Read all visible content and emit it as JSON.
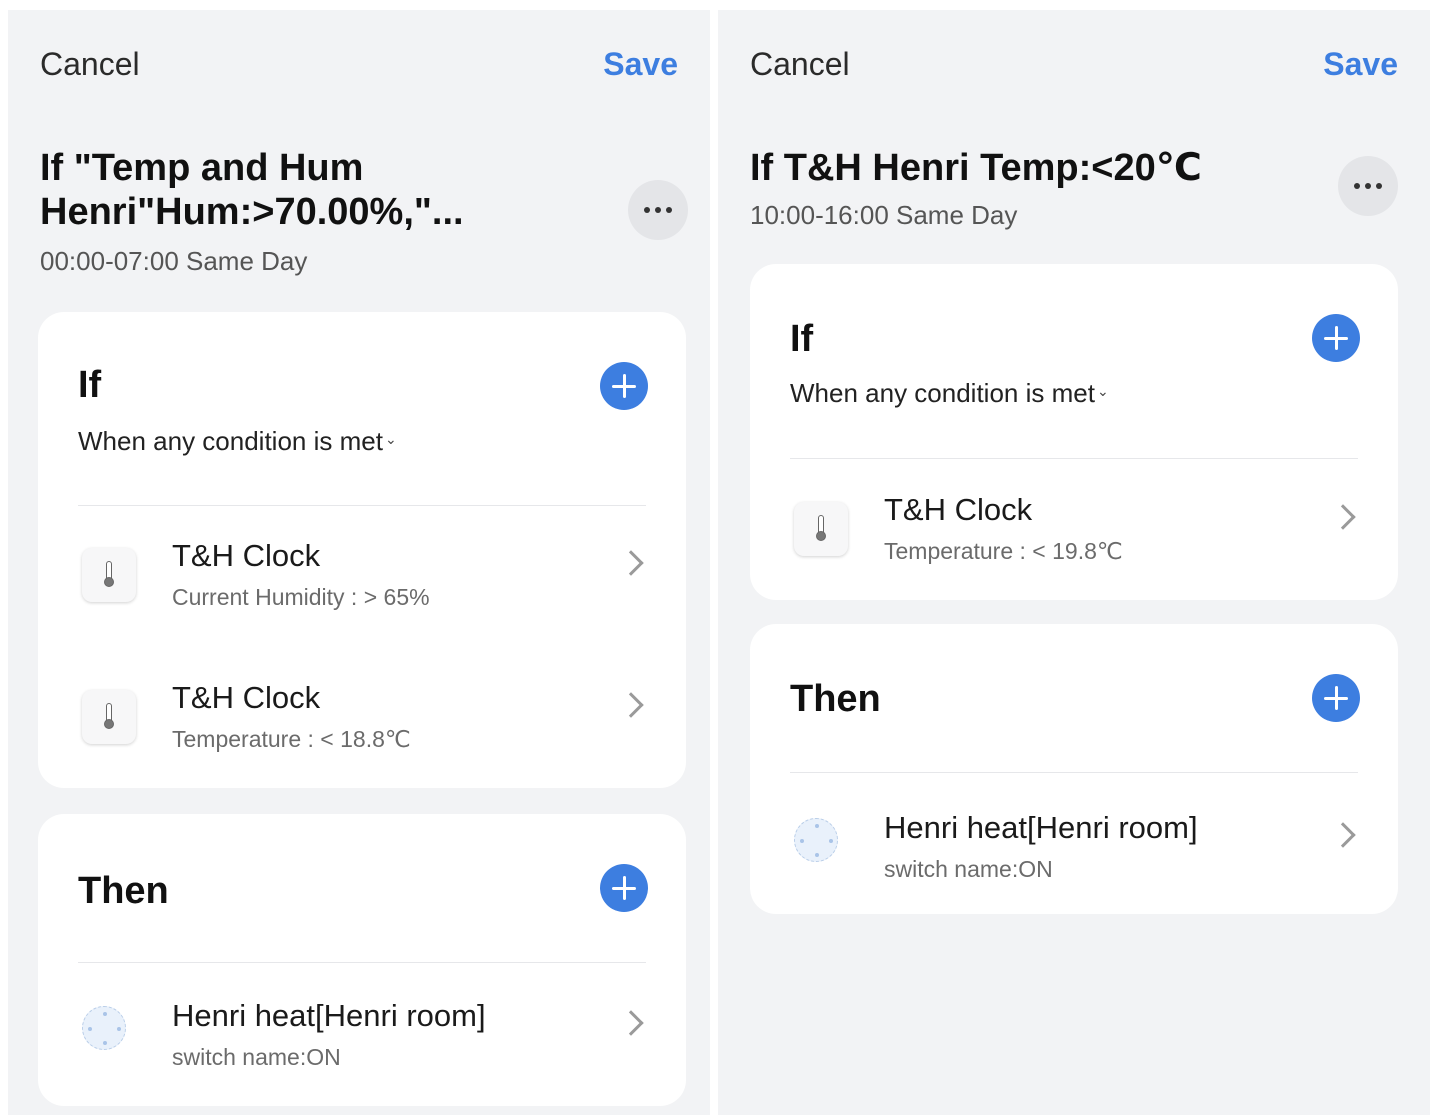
{
  "left": {
    "cancel_label": "Cancel",
    "save_label": "Save",
    "title_line1": "If \"Temp and Hum",
    "title_line2": "Henri\"Hum:>70.00%,\"...",
    "schedule": "00:00-07:00 Same Day",
    "if_card": {
      "heading": "If",
      "mode": "When any condition is met",
      "conditions": [
        {
          "device": "T&H Clock",
          "detail": "Current Humidity : > 65%"
        },
        {
          "device": "T&H Clock",
          "detail": "Temperature : < 18.8℃"
        }
      ]
    },
    "then_card": {
      "heading": "Then",
      "actions": [
        {
          "device": "Henri heat[Henri room]",
          "detail": "switch name:ON"
        }
      ]
    }
  },
  "right": {
    "cancel_label": "Cancel",
    "save_label": "Save",
    "title_line1": "If T&H Henri Temp:<20℃",
    "schedule": "10:00-16:00 Same Day",
    "if_card": {
      "heading": "If",
      "mode": "When any condition is met",
      "conditions": [
        {
          "device": "T&H Clock",
          "detail": "Temperature : < 19.8℃"
        }
      ]
    },
    "then_card": {
      "heading": "Then",
      "actions": [
        {
          "device": "Henri heat[Henri room]",
          "detail": "switch name:ON"
        }
      ]
    }
  },
  "colors": {
    "accent": "#3d7ee0",
    "background": "#f2f3f5",
    "card": "#ffffff"
  },
  "icons": [
    "more-icon",
    "add-icon",
    "thermometer-icon",
    "heater-icon",
    "chevron-right-icon"
  ]
}
